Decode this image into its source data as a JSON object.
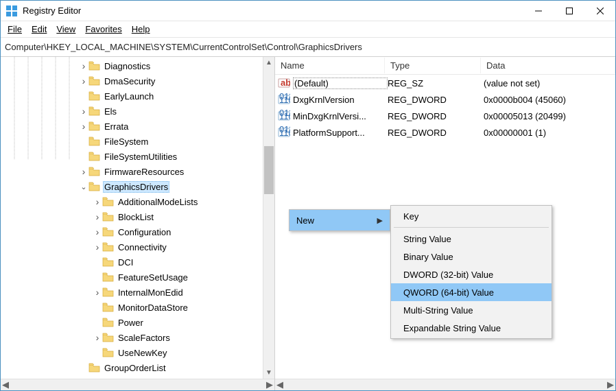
{
  "window": {
    "title": "Registry Editor"
  },
  "menu": {
    "file": "File",
    "edit": "Edit",
    "view": "View",
    "favorites": "Favorites",
    "help": "Help"
  },
  "address": "Computer\\HKEY_LOCAL_MACHINE\\SYSTEM\\CurrentControlSet\\Control\\GraphicsDrivers",
  "columns": {
    "name": "Name",
    "type": "Type",
    "data": "Data"
  },
  "tree": {
    "items": [
      {
        "label": "Diagnostics",
        "expander": ">",
        "indent": 114
      },
      {
        "label": "DmaSecurity",
        "expander": ">",
        "indent": 114
      },
      {
        "label": "EarlyLaunch",
        "expander": "",
        "indent": 114
      },
      {
        "label": "Els",
        "expander": ">",
        "indent": 114
      },
      {
        "label": "Errata",
        "expander": ">",
        "indent": 114
      },
      {
        "label": "FileSystem",
        "expander": "",
        "indent": 114
      },
      {
        "label": "FileSystemUtilities",
        "expander": "",
        "indent": 114
      },
      {
        "label": "FirmwareResources",
        "expander": ">",
        "indent": 114
      },
      {
        "label": "GraphicsDrivers",
        "expander": "v",
        "indent": 114,
        "selected": true
      },
      {
        "label": "AdditionalModeLists",
        "expander": ">",
        "indent": 134
      },
      {
        "label": "BlockList",
        "expander": ">",
        "indent": 134
      },
      {
        "label": "Configuration",
        "expander": ">",
        "indent": 134
      },
      {
        "label": "Connectivity",
        "expander": ">",
        "indent": 134
      },
      {
        "label": "DCI",
        "expander": "",
        "indent": 134
      },
      {
        "label": "FeatureSetUsage",
        "expander": "",
        "indent": 134
      },
      {
        "label": "InternalMonEdid",
        "expander": ">",
        "indent": 134
      },
      {
        "label": "MonitorDataStore",
        "expander": "",
        "indent": 134
      },
      {
        "label": "Power",
        "expander": "",
        "indent": 134
      },
      {
        "label": "ScaleFactors",
        "expander": ">",
        "indent": 134
      },
      {
        "label": "UseNewKey",
        "expander": "",
        "indent": 134
      },
      {
        "label": "GroupOrderList",
        "expander": "",
        "indent": 114
      }
    ]
  },
  "values": [
    {
      "icon": "string",
      "name": "(Default)",
      "type": "REG_SZ",
      "data": "(value not set)",
      "selected": true
    },
    {
      "icon": "dword",
      "name": "DxgKrnlVersion",
      "type": "REG_DWORD",
      "data": "0x0000b004 (45060)"
    },
    {
      "icon": "dword",
      "name": "MinDxgKrnlVersi...",
      "type": "REG_DWORD",
      "data": "0x00005013 (20499)"
    },
    {
      "icon": "dword",
      "name": "PlatformSupport...",
      "type": "REG_DWORD",
      "data": "0x00000001 (1)"
    }
  ],
  "context1": {
    "new": "New"
  },
  "context2": {
    "key": "Key",
    "string": "String Value",
    "binary": "Binary Value",
    "dword": "DWORD (32-bit) Value",
    "qword": "QWORD (64-bit) Value",
    "multistring": "Multi-String Value",
    "expstring": "Expandable String Value"
  }
}
